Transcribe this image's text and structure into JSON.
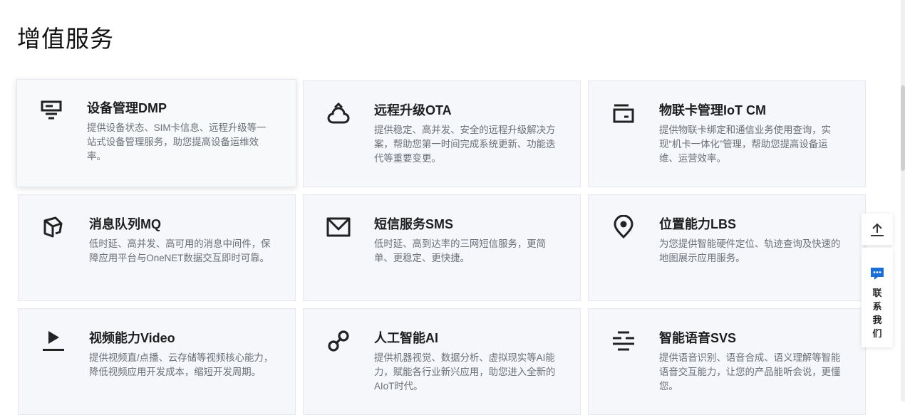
{
  "page": {
    "title": "增值服务"
  },
  "services": [
    {
      "name": "设备管理DMP",
      "icon": "device-panel-icon",
      "desc": "提供设备状态、SIM卡信息、远程升级等一站式设备管理服务，助您提高设备运维效率。"
    },
    {
      "name": "远程升级OTA",
      "icon": "cloud-upgrade-icon",
      "desc": "提供稳定、高并发、安全的远程升级解决方案，帮助您第一时间完成系统更新、功能迭代等重要变更。"
    },
    {
      "name": "物联卡管理IoT CM",
      "icon": "sim-card-icon",
      "desc": "提供物联卡绑定和通信业务使用查询，实现“机卡一体化”管理，帮助您提高设备运维、运营效率。"
    },
    {
      "name": "消息队列MQ",
      "icon": "message-queue-icon",
      "desc": "低时延、高并发、高可用的消息中间件，保障应用平台与OneNET数据交互即时可靠。"
    },
    {
      "name": "短信服务SMS",
      "icon": "envelope-icon",
      "desc": "低时延、高到达率的三网短信服务，更简单、更稳定、更快捷。"
    },
    {
      "name": "位置能力LBS",
      "icon": "location-pin-icon",
      "desc": "为您提供智能硬件定位、轨迹查询及快速的地图展示应用服务。"
    },
    {
      "name": "视频能力Video",
      "icon": "video-play-icon",
      "desc": "提供视频直/点播、云存储等视频核心能力，降低视频应用开发成本，缩短开发周期。"
    },
    {
      "name": "人工智能AI",
      "icon": "ai-link-icon",
      "desc": "提供机器视觉、数据分析、虚拟现实等AI能力，赋能各行业新兴应用，助您进入全新的AIoT时代。"
    },
    {
      "name": "智能语音SVS",
      "icon": "voice-lines-icon",
      "desc": "提供语音识别、语音合成、语义理解等智能语音交互能力，让您的产品能听会说，更懂您。"
    }
  ],
  "float_bar": {
    "contact_label": "联系我们"
  },
  "colors": {
    "accent": "#1a6ed8",
    "card_bg": "#f5f7fa",
    "icon": "#222222"
  }
}
